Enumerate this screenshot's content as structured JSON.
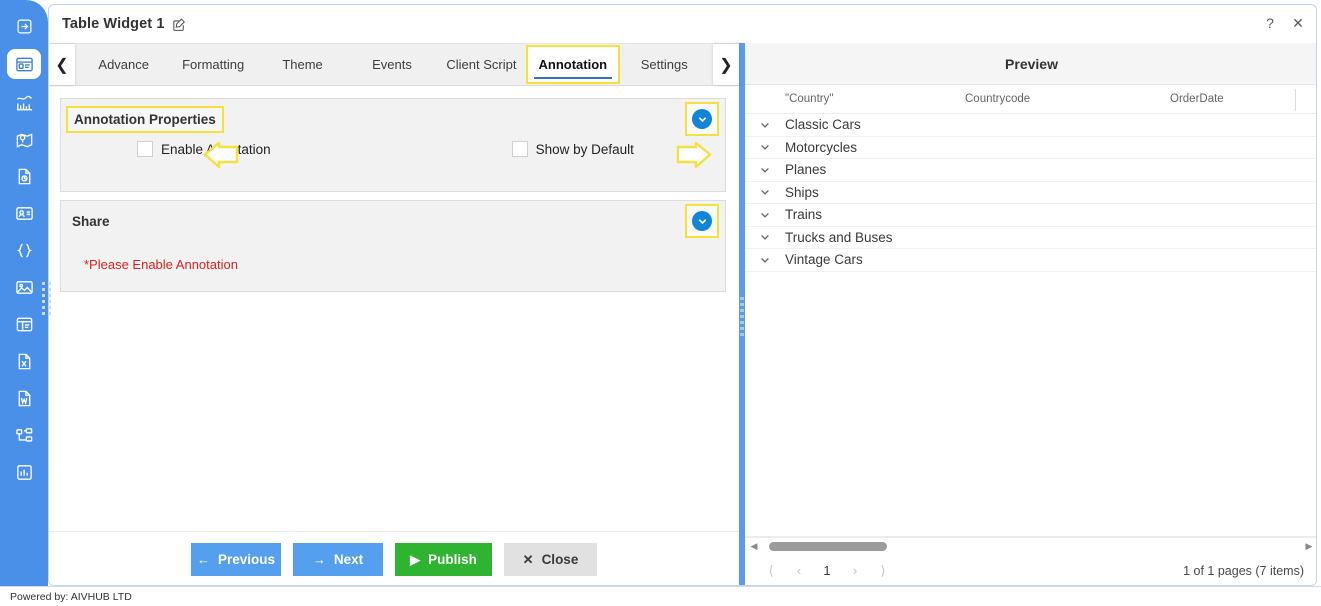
{
  "rail": {
    "items": [
      {
        "icon": "export-arrow-icon",
        "name": "sidebar-item-export"
      },
      {
        "icon": "widget-card-icon",
        "name": "sidebar-item-widget"
      },
      {
        "icon": "chart-trend-icon",
        "name": "sidebar-item-chart"
      },
      {
        "icon": "map-pin-icon",
        "name": "sidebar-item-map"
      },
      {
        "icon": "document-refresh-icon",
        "name": "sidebar-item-document"
      },
      {
        "icon": "contact-card-icon",
        "name": "sidebar-item-contact"
      },
      {
        "icon": "code-braces-icon",
        "name": "sidebar-item-code"
      },
      {
        "icon": "image-icon",
        "name": "sidebar-item-image"
      },
      {
        "icon": "layout-panel-icon",
        "name": "sidebar-item-layout"
      },
      {
        "icon": "excel-file-icon",
        "name": "sidebar-item-excel"
      },
      {
        "icon": "word-file-icon",
        "name": "sidebar-item-word"
      },
      {
        "icon": "hierarchy-icon",
        "name": "sidebar-item-hierarchy"
      },
      {
        "icon": "analytics-icon",
        "name": "sidebar-item-analytics"
      }
    ]
  },
  "titlebar": {
    "title": "Table Widget 1",
    "edit_icon": "pencil-square-icon",
    "help_label": "?",
    "close_label": "✕"
  },
  "tabs": {
    "prev_arrow": "❮",
    "next_arrow": "❯",
    "items": [
      {
        "label": "Advance",
        "active": false
      },
      {
        "label": "Formatting",
        "active": false
      },
      {
        "label": "Theme",
        "active": false
      },
      {
        "label": "Events",
        "active": false
      },
      {
        "label": "Client Script",
        "active": false
      },
      {
        "label": "Annotation",
        "active": true
      },
      {
        "label": "Settings",
        "active": false
      }
    ]
  },
  "sections": {
    "annotation": {
      "title": "Annotation Properties",
      "collapse_icon": "chevron-down-icon",
      "checkboxes": [
        {
          "label": "Enable Annotation",
          "checked": false
        },
        {
          "label": "Show by Default",
          "checked": false
        }
      ]
    },
    "share": {
      "title": "Share",
      "collapse_icon": "chevron-down-icon",
      "warning": "*Please Enable Annotation"
    }
  },
  "actions": [
    {
      "label": "Previous",
      "icon": "←",
      "style": "blue",
      "name": "previous-button"
    },
    {
      "label": "Next",
      "icon": "→",
      "style": "blue",
      "name": "next-button"
    },
    {
      "label": "Publish",
      "icon": "▶",
      "style": "green",
      "name": "publish-button"
    },
    {
      "label": "Close",
      "icon": "✕",
      "style": "grey",
      "name": "close-button"
    }
  ],
  "preview": {
    "title": "Preview",
    "columns": [
      "\"Country\"",
      "Countrycode",
      "OrderDate"
    ],
    "rows": [
      {
        "label": "Classic Cars"
      },
      {
        "label": "Motorcycles"
      },
      {
        "label": "Planes"
      },
      {
        "label": "Ships"
      },
      {
        "label": "Trains"
      },
      {
        "label": "Trucks and Buses"
      },
      {
        "label": "Vintage Cars"
      }
    ],
    "expand_icon": "chevron-down-icon",
    "hscroll": {
      "left_arrow": "◀",
      "right_arrow": "▶"
    },
    "pager": {
      "first": "⟨",
      "prev": "‹",
      "current": "1",
      "next": "›",
      "last": "⟩",
      "info": "1 of 1 pages (7 items)"
    }
  },
  "footer": {
    "text": "Powered by: AIVHUB LTD"
  },
  "colors": {
    "rail_blue": "#4a90e8",
    "accent_blue": "#1285d8",
    "highlight_yellow": "#f5e03c",
    "publish_green": "#2eb430",
    "warning_red": "#e02222"
  }
}
